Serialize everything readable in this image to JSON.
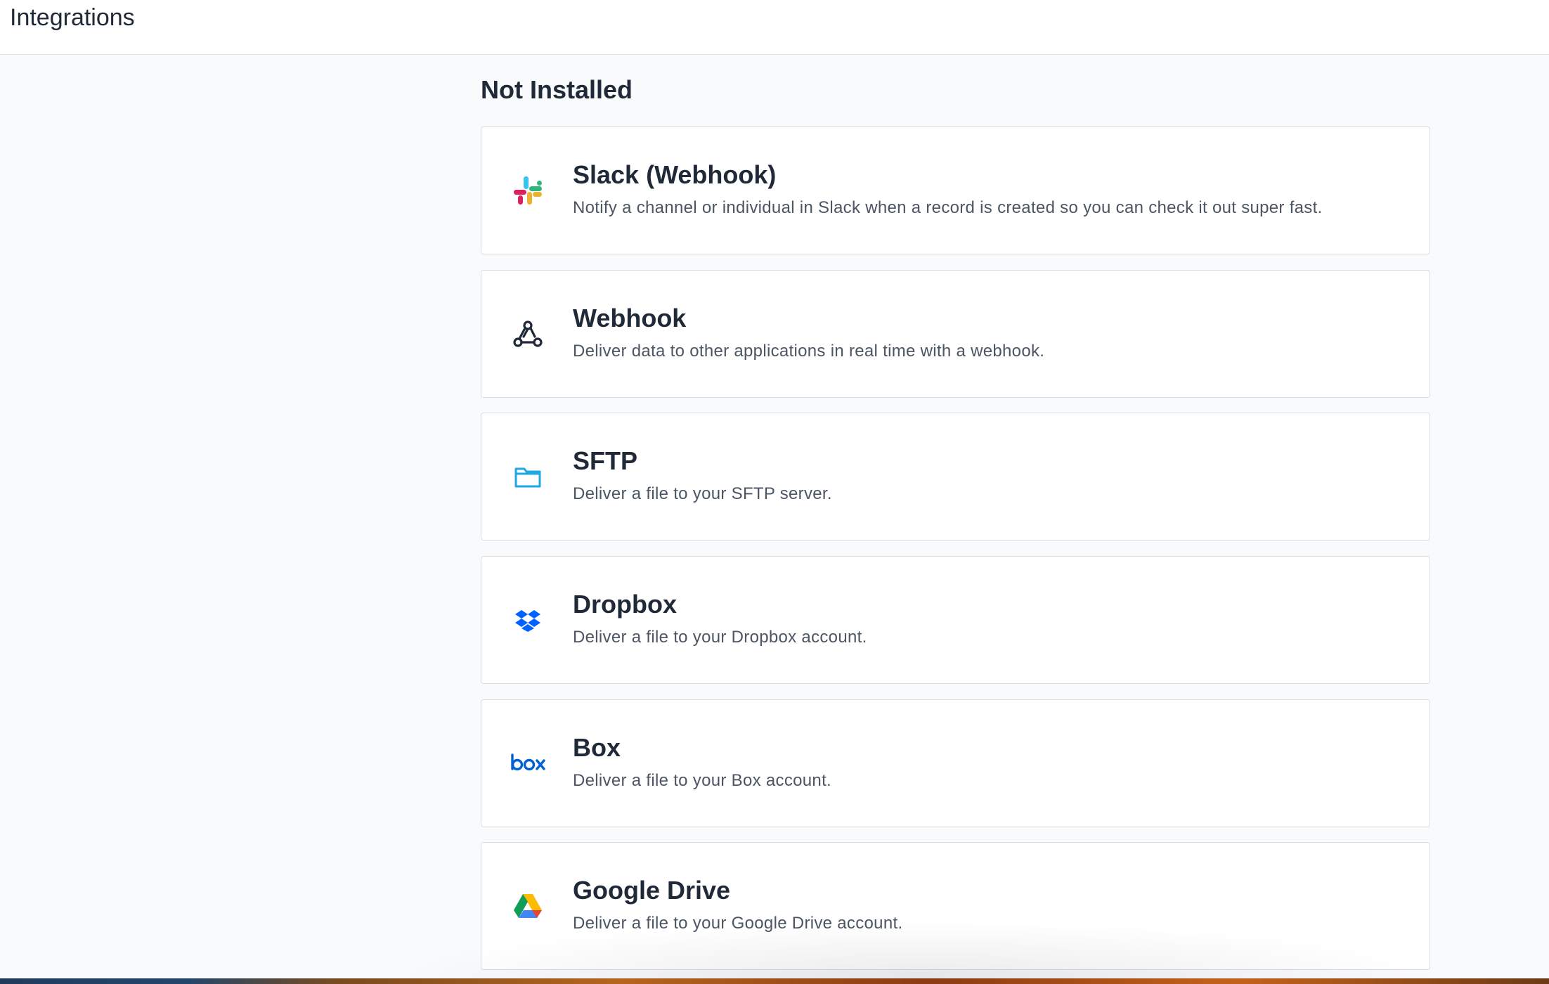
{
  "header": {
    "title": "Integrations"
  },
  "section": {
    "title": "Not Installed"
  },
  "integrations": [
    {
      "name": "Slack (Webhook)",
      "description": "Notify a channel or individual in Slack when a record is created so you can check it out super fast.",
      "icon": "slack-icon"
    },
    {
      "name": "Webhook",
      "description": "Deliver data to other applications in real time with a webhook.",
      "icon": "webhook-icon"
    },
    {
      "name": "SFTP",
      "description": "Deliver a file to your SFTP server.",
      "icon": "folder-icon"
    },
    {
      "name": "Dropbox",
      "description": "Deliver a file to your Dropbox account.",
      "icon": "dropbox-icon"
    },
    {
      "name": "Box",
      "description": "Deliver a file to your Box account.",
      "icon": "box-icon"
    },
    {
      "name": "Google Drive",
      "description": "Deliver a file to your Google Drive account.",
      "icon": "google-drive-icon"
    }
  ],
  "colors": {
    "background": "#f9fafb",
    "card_border": "#d9dde3",
    "text_primary": "#1f2937",
    "text_secondary": "#4b5563",
    "sftp_blue": "#1ea7e1",
    "dropbox_blue": "#0061ff",
    "box_blue": "#0061d5"
  }
}
